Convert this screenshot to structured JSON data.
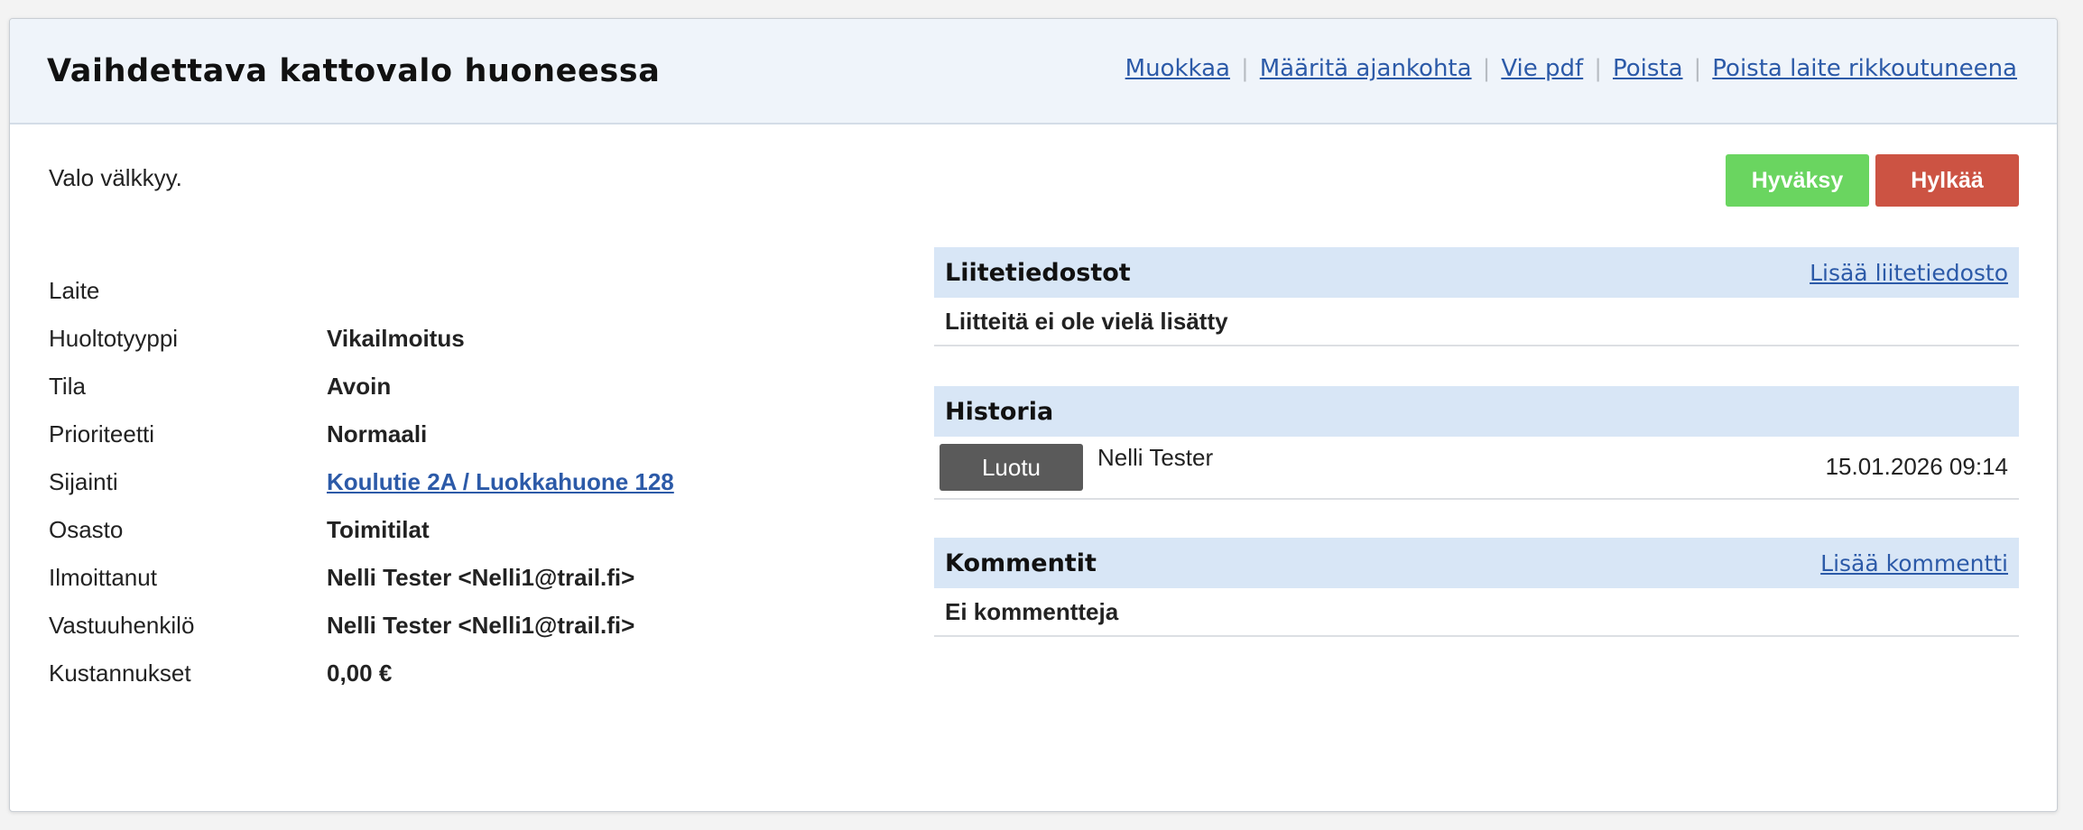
{
  "header": {
    "title": "Vaihdettava kattovalo huoneessa",
    "actions": {
      "edit": "Muokkaa",
      "schedule": "Määritä ajankohta",
      "export_pdf": "Vie pdf",
      "delete": "Poista",
      "delete_broken": "Poista laite rikkoutuneena"
    }
  },
  "description": "Valo välkkyy.",
  "buttons": {
    "approve": "Hyväksy",
    "reject": "Hylkää"
  },
  "colors": {
    "approve": "#6ad560",
    "reject": "#cc5343",
    "link": "#2c5aa8",
    "section_header": "#d8e6f6",
    "history_badge": "#5a5a5a"
  },
  "details": {
    "device": {
      "label": "Laite",
      "value": ""
    },
    "service_type": {
      "label": "Huoltotyyppi",
      "value": "Vikailmoitus"
    },
    "status": {
      "label": "Tila",
      "value": "Avoin"
    },
    "priority": {
      "label": "Prioriteetti",
      "value": "Normaali"
    },
    "location": {
      "label": "Sijainti",
      "value": "Koulutie 2A / Luokkahuone 128"
    },
    "department": {
      "label": "Osasto",
      "value": "Toimitilat"
    },
    "reporter": {
      "label": "Ilmoittanut",
      "value": "Nelli Tester <Nelli1@trail.fi>"
    },
    "responsible": {
      "label": "Vastuuhenkilö",
      "value": "Nelli Tester <Nelli1@trail.fi>"
    },
    "costs": {
      "label": "Kustannukset",
      "value": "0,00 €"
    }
  },
  "attachments": {
    "title": "Liitetiedostot",
    "add_link": "Lisää liitetiedosto",
    "empty": "Liitteitä ei ole vielä lisätty"
  },
  "history": {
    "title": "Historia",
    "entries": [
      {
        "event": "Luotu",
        "user": "Nelli Tester",
        "time": "15.01.2026 09:14"
      }
    ]
  },
  "comments": {
    "title": "Kommentit",
    "add_link": "Lisää kommentti",
    "empty": "Ei kommentteja"
  }
}
